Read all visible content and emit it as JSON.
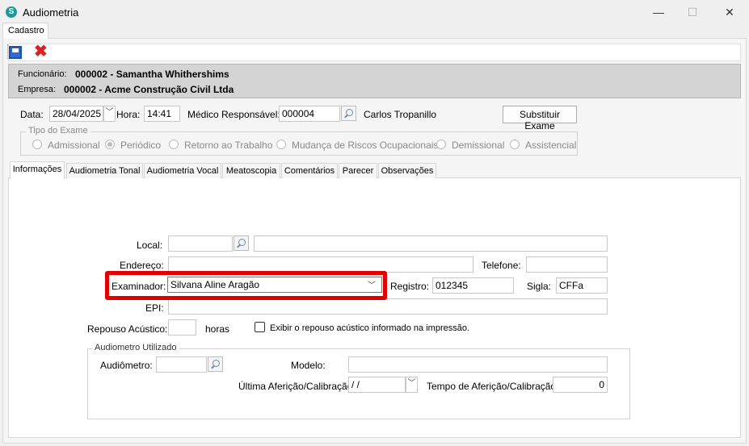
{
  "window": {
    "title": "Audiometria",
    "minimize_glyph": "—",
    "maximize_glyph": "☐",
    "close_glyph": "✕",
    "icon_glyph": "S"
  },
  "top_tab": "Cadastro",
  "toolbar": {
    "save_icon": "save-icon",
    "close_glyph": "✖"
  },
  "header": {
    "funcionario_label": "Funcionário:",
    "funcionario_value": "000002 - Samantha Whithershims",
    "empresa_label": "Empresa:",
    "empresa_value": "000002 - Acme Construção Civil Ltda"
  },
  "form": {
    "data_label": "Data:",
    "data_value": "28/04/2025",
    "hora_label": "Hora:",
    "hora_value": "14:41",
    "medico_label": "Médico Responsável:",
    "medico_code": "000004",
    "medico_name": "Carlos Tropanillo",
    "substituir_button": "Substituir Exame",
    "dropdown_glyph": "﹀"
  },
  "tipo_exame": {
    "title": "Tipo do Exame",
    "options": [
      {
        "label": "Admissional",
        "selected": false
      },
      {
        "label": "Periódico",
        "selected": true
      },
      {
        "label": "Retorno ao Trabalho",
        "selected": false
      },
      {
        "label": "Mudança de Riscos Ocupacionais",
        "selected": false
      },
      {
        "label": "Demissional",
        "selected": false
      },
      {
        "label": "Assistencial",
        "selected": false
      }
    ]
  },
  "tabs": [
    {
      "label": "Informações",
      "active": true
    },
    {
      "label": "Audiometria Tonal",
      "active": false
    },
    {
      "label": "Audiometria Vocal",
      "active": false
    },
    {
      "label": "Meatoscopia",
      "active": false
    },
    {
      "label": "Comentários",
      "active": false
    },
    {
      "label": "Parecer",
      "active": false
    },
    {
      "label": "Observações",
      "active": false
    }
  ],
  "info": {
    "local_label": "Local:",
    "local_code": "",
    "local_name": "",
    "endereco_label": "Endereço:",
    "endereco_value": "",
    "telefone_label": "Telefone:",
    "telefone_value": "",
    "examinador_label": "Examinador:",
    "examinador_value": "Silvana Aline Aragão",
    "registro_label": "Registro:",
    "registro_value": "012345",
    "sigla_label": "Sigla:",
    "sigla_value": "CFFa",
    "epi_label": "EPI:",
    "epi_value": "",
    "repouso_label": "Repouso Acústico:",
    "repouso_value": "",
    "horas_label": "horas",
    "exibir_label": "Exibir o repouso acústico informado na impressão.",
    "exibir_checked": false
  },
  "audiometro": {
    "title": "Audiometro Utilizado",
    "audiometro_label": "Audiômetro:",
    "audiometro_value": "",
    "modelo_label": "Modelo:",
    "modelo_value": "",
    "afericao_label": "Última Aferição/Calibração:",
    "afericao_value": " / /",
    "tempo_label": "Tempo de Aferição/Calibração:",
    "tempo_value": "0"
  },
  "colors": {
    "highlight": "#e10000",
    "accent_blue": "#2f6bd0",
    "close_red": "#e02020"
  }
}
